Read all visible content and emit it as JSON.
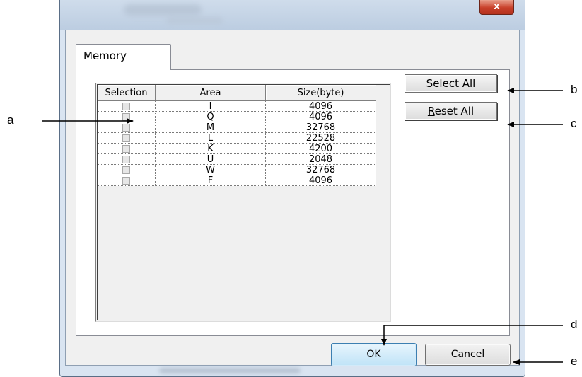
{
  "dialog": {
    "tab_label": "Memory",
    "close_glyph": "x",
    "select_all": {
      "prefix": "Select ",
      "mnemonic": "A",
      "suffix": "ll"
    },
    "reset_all": {
      "prefix": "",
      "mnemonic": "R",
      "suffix": "eset All"
    },
    "ok_label": "OK",
    "cancel_label": "Cancel"
  },
  "table": {
    "columns": [
      "Selection",
      "Area",
      "Size(byte)"
    ],
    "rows": [
      {
        "area": "I",
        "size": "4096"
      },
      {
        "area": "Q",
        "size": "4096"
      },
      {
        "area": "M",
        "size": "32768"
      },
      {
        "area": "L",
        "size": "22528"
      },
      {
        "area": "K",
        "size": "4200"
      },
      {
        "area": "U",
        "size": "2048"
      },
      {
        "area": "W",
        "size": "32768"
      },
      {
        "area": "F",
        "size": "4096"
      }
    ]
  },
  "callouts": {
    "a": "a",
    "b": "b",
    "c": "c",
    "d": "d",
    "e": "e"
  }
}
